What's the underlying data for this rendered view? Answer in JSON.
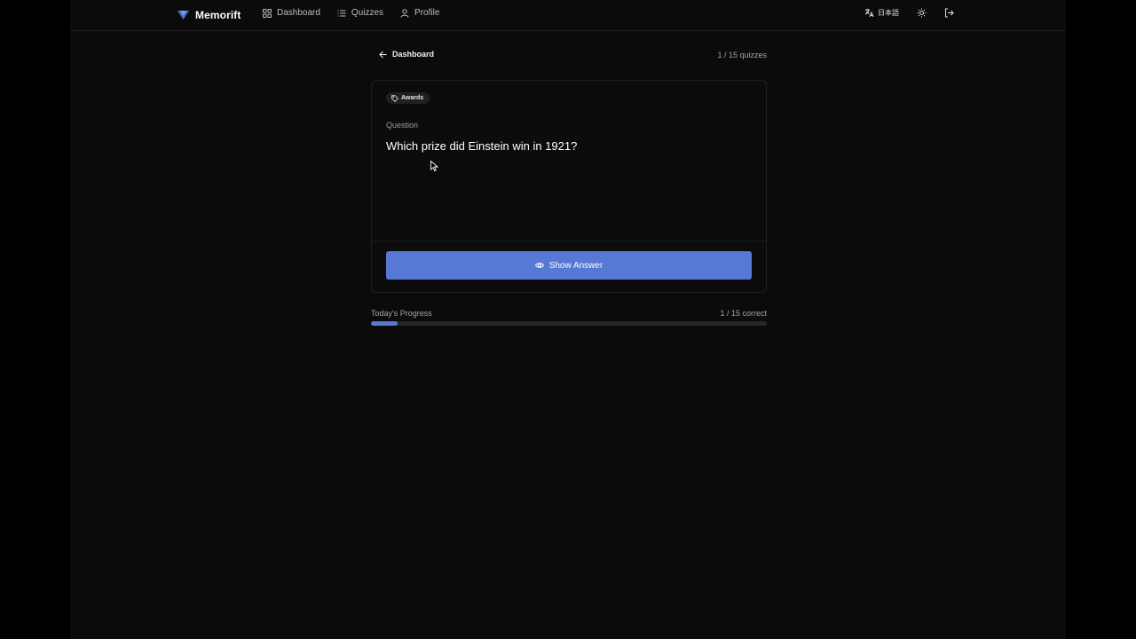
{
  "header": {
    "brand": "Memorift",
    "nav": [
      {
        "label": "Dashboard",
        "icon": "grid-icon"
      },
      {
        "label": "Quizzes",
        "icon": "list-icon"
      },
      {
        "label": "Profile",
        "icon": "user-icon"
      }
    ],
    "language": "日本語",
    "icons": [
      "translate-icon",
      "sun-icon",
      "logout-icon"
    ]
  },
  "subheader": {
    "back_label": "Dashboard",
    "quiz_count": "1 / 15 quizzes"
  },
  "card": {
    "tag": "Awards",
    "question_label": "Question",
    "question": "Which prize did Einstein win in 1921?",
    "show_answer_label": "Show Answer"
  },
  "progress": {
    "label": "Today's Progress",
    "count": "1 / 15 correct",
    "fraction": 0.0667
  },
  "colors": {
    "accent": "#5878d6",
    "background": "#0b0b0b",
    "outer": "#000000"
  }
}
